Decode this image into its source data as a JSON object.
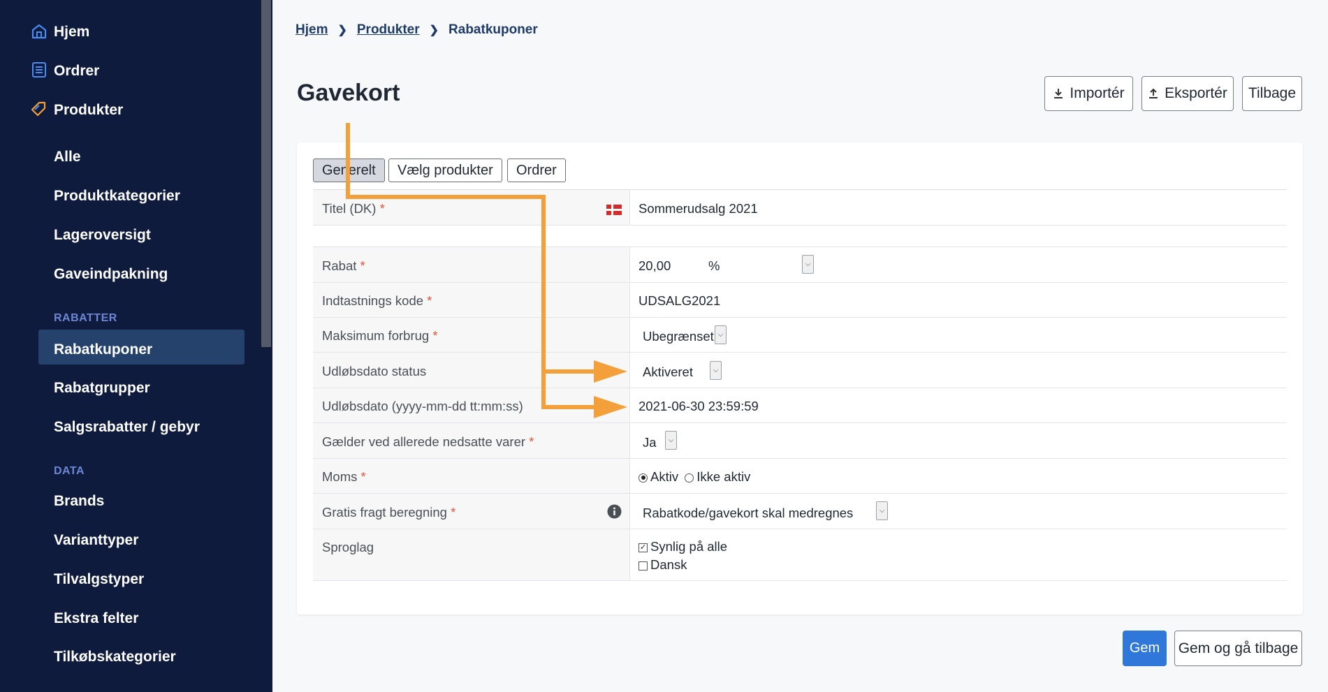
{
  "sidebar": {
    "top_items": [
      {
        "label": "Hjem",
        "icon": "home-icon"
      },
      {
        "label": "Ordrer",
        "icon": "list-icon"
      },
      {
        "label": "Produkter",
        "icon": "tag-icon"
      }
    ],
    "product_items": [
      "Alle",
      "Produktkategorier",
      "Lageroversigt",
      "Gaveindpakning"
    ],
    "section_rabatter": "RABATTER",
    "rabatter_items": [
      "Rabatkuponer",
      "Rabatgrupper",
      "Salgsrabatter / gebyr"
    ],
    "section_data": "DATA",
    "data_items": [
      "Brands",
      "Varianttyper",
      "Tilvalgstyper",
      "Ekstra felter",
      "Tilkøbskategorier"
    ]
  },
  "breadcrumb": {
    "home": "Hjem",
    "products": "Produkter",
    "current": "Rabatkuponer"
  },
  "page_title": "Gavekort",
  "header_buttons": {
    "import": "Importér",
    "export": "Eksportér",
    "back": "Tilbage"
  },
  "tabs": [
    "Generelt",
    "Vælg produkter",
    "Ordrer"
  ],
  "form": {
    "title_label": "Titel (DK)",
    "title_value": "Sommerudsalg 2021",
    "rabat_label": "Rabat",
    "rabat_value": "20,00",
    "rabat_unit": "%",
    "code_label": "Indtastnings kode",
    "code_value": "UDSALG2021",
    "max_label": "Maksimum forbrug",
    "max_value": "Ubegrænset",
    "expiry_status_label": "Udløbsdato status",
    "expiry_status_value": "Aktiveret",
    "expiry_label": "Udløbsdato (yyyy-mm-dd tt:mm:ss)",
    "expiry_value": "2021-06-30 23:59:59",
    "reduced_label": "Gælder ved allerede nedsatte varer",
    "reduced_value": "Ja",
    "vat_label": "Moms",
    "vat_on": "Aktiv",
    "vat_off": "Ikke aktiv",
    "shipping_label": "Gratis fragt beregning",
    "shipping_value": "Rabatkode/gavekort skal medregnes",
    "lang_label": "Sproglag",
    "lang_all": "Synlig på alle",
    "lang_dk": "Dansk",
    "required_mark": "*"
  },
  "footer_buttons": {
    "save": "Gem",
    "save_back": "Gem og gå tilbage"
  },
  "colors": {
    "sidebar_bg": "#0f1b3d",
    "active_bg": "#24426b",
    "accent": "#2f77d9",
    "annotation": "#f3a03a"
  }
}
